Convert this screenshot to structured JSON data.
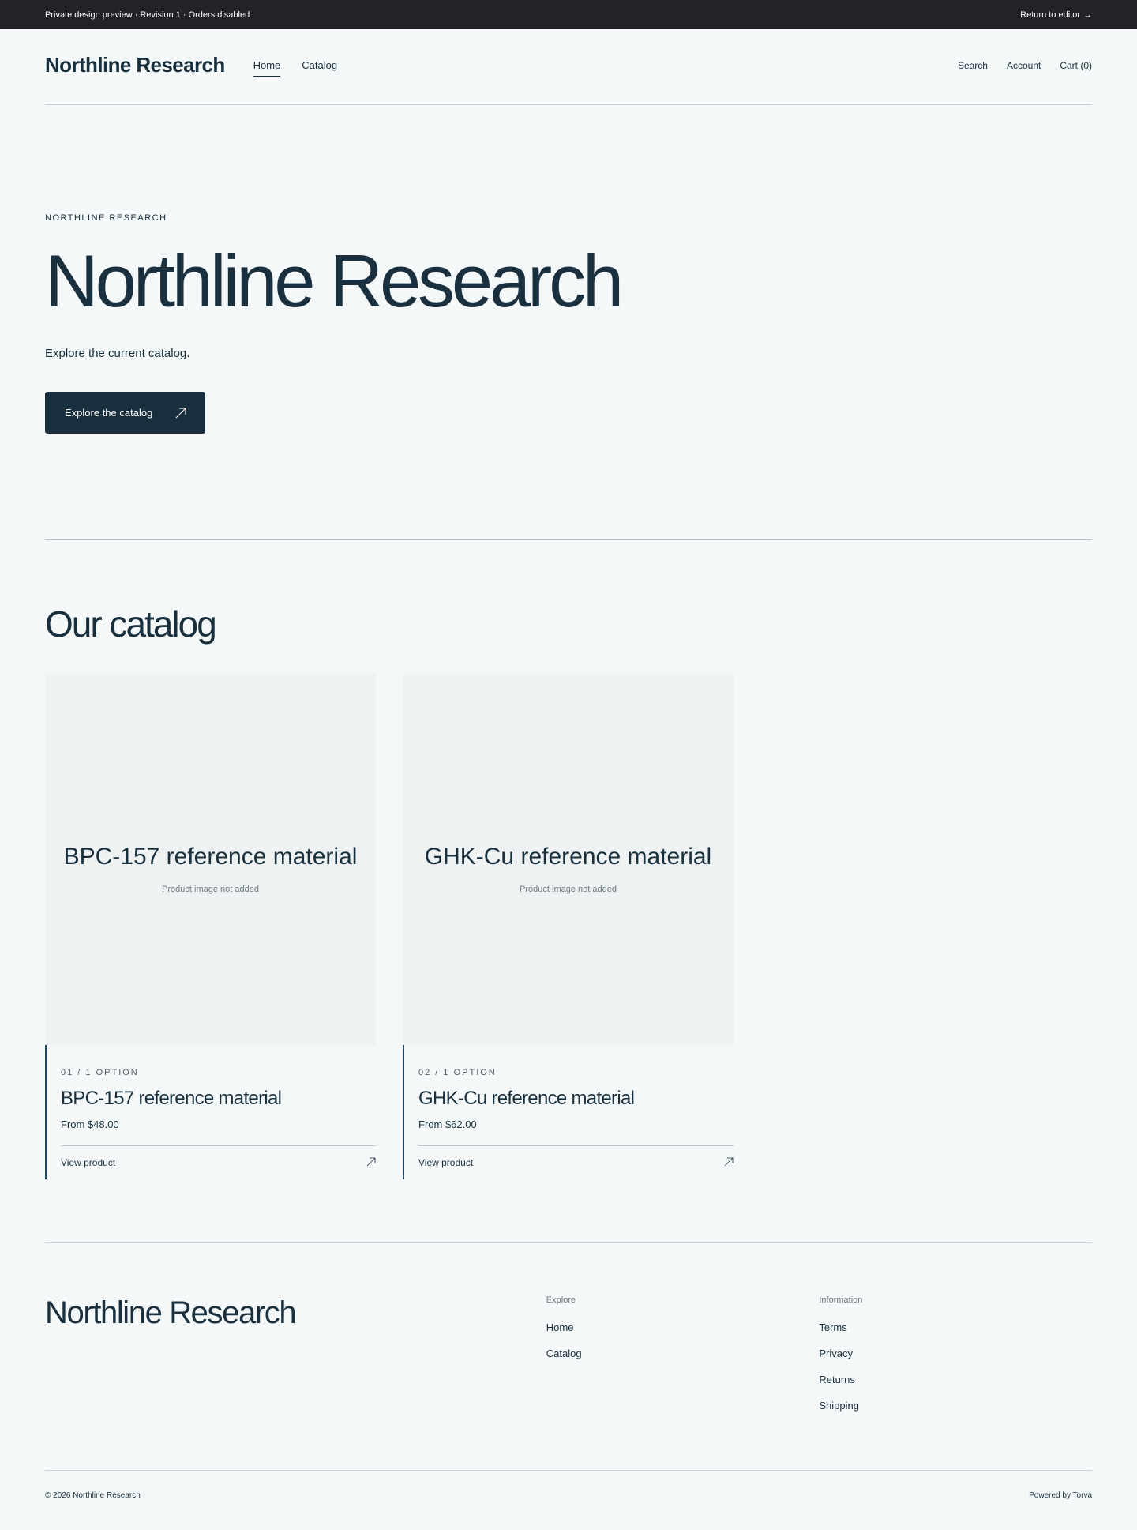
{
  "preview_bar": {
    "status": "Private design preview · Revision 1 · Orders disabled",
    "return_label": "Return to editor",
    "return_arrow": "→"
  },
  "header": {
    "brand": "Northline Research",
    "nav": [
      {
        "label": "Home",
        "active": true
      },
      {
        "label": "Catalog",
        "active": false
      }
    ],
    "utility": {
      "search": "Search",
      "account": "Account",
      "cart": "Cart (0)"
    }
  },
  "hero": {
    "eyebrow": "NORTHLINE RESEARCH",
    "title": "Northline Research",
    "subtitle": "Explore the current catalog.",
    "cta_label": "Explore the catalog",
    "cta_icon": "arrow-up-right-icon"
  },
  "catalog": {
    "heading": "Our catalog",
    "products": [
      {
        "image_title": "BPC-157 reference material",
        "image_note": "Product image not added",
        "meta": "01 / 1 OPTION",
        "name": "BPC-157 reference material",
        "price": "From $48.00",
        "link_label": "View product"
      },
      {
        "image_title": "GHK-Cu reference material",
        "image_note": "Product image not added",
        "meta": "02 / 1 OPTION",
        "name": "GHK-Cu reference material",
        "price": "From $62.00",
        "link_label": "View product"
      }
    ]
  },
  "footer": {
    "brand": "Northline Research",
    "explore": {
      "heading": "Explore",
      "links": [
        "Home",
        "Catalog"
      ]
    },
    "information": {
      "heading": "Information",
      "links": [
        "Terms",
        "Privacy",
        "Returns",
        "Shipping"
      ]
    },
    "copyright": "© 2026 Northline Research",
    "powered_by": "Powered by Torva"
  },
  "colors": {
    "background": "#f5f8f9",
    "ink": "#182f3d",
    "topbar": "#222227",
    "button": "#1a2f3d",
    "card_accent": "#1b4b6c",
    "placeholder": "#eff2f3"
  }
}
